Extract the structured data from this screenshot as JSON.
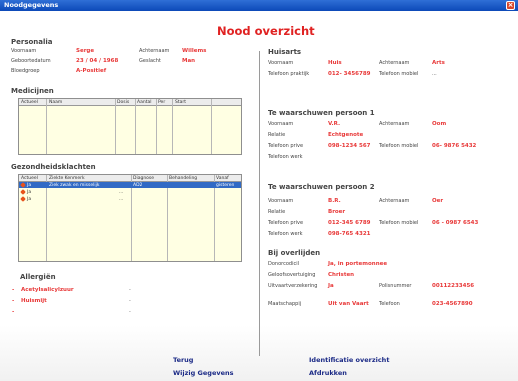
{
  "window": {
    "title": "Noodgegevens",
    "close_glyph": "×"
  },
  "heading": "Nood overzicht",
  "personalia": {
    "title": "Personalia",
    "voornaam_label": "Voornaam",
    "voornaam": "Serge",
    "achternaam_label": "Achternaam",
    "achternaam": "Willems",
    "geboortedatum_label": "Geboortedatum",
    "geboortedatum": "23 / 04 / 1968",
    "geslacht_label": "Geslacht",
    "geslacht": "Man",
    "bloedgroep_label": "Bloedgroep",
    "bloedgroep": "A-Positief"
  },
  "medicijnen": {
    "title": "Medicijnen",
    "columns": [
      "Actueel",
      "Naam",
      "Dosis",
      "Aantal",
      "Per",
      "Start"
    ]
  },
  "klachten": {
    "title": "Gezondheidsklachten",
    "columns": [
      "Actueel",
      "Ziekte Kenmerk",
      "Diagnose",
      "Behandeling",
      "Vanaf"
    ],
    "rows": [
      {
        "actueel": "Ja",
        "kenmerk": "Ziek zwak en misselijk",
        "diagnose": "AD2",
        "behandeling": "",
        "vanaf": "gisteren",
        "selected": true
      },
      {
        "actueel": "Ja",
        "kenmerk": "",
        "diagnose": "...",
        "behandeling": "",
        "vanaf": "",
        "selected": false
      },
      {
        "actueel": "Ja",
        "kenmerk": "",
        "diagnose": "...",
        "behandeling": "",
        "vanaf": "",
        "selected": false
      }
    ]
  },
  "allergien": {
    "title": "Allergiën",
    "items": [
      "Acetylsalicylzuur",
      "Huismijt",
      ""
    ]
  },
  "huisarts": {
    "title": "Huisarts",
    "voornaam_label": "Voornaam",
    "voornaam": "Huis",
    "achternaam_label": "Achternaam",
    "achternaam": "Arts",
    "telefoon_praktijk_label": "Telefoon praktijk",
    "telefoon_praktijk": "012- 3456789",
    "telefoon_mobiel_label": "Telefoon mobiel",
    "telefoon_mobiel": "..."
  },
  "persoon1": {
    "title": "Te waarschuwen persoon 1",
    "voornaam_label": "Voornaam",
    "voornaam": "V.R.",
    "achternaam_label": "Achternaam",
    "achternaam": "Oom",
    "relatie_label": "Relatie",
    "relatie": "Echtgenote",
    "telefoon_prive_label": "Telefoon prive",
    "telefoon_prive": "098-1234 567",
    "telefoon_mobiel_label": "Telefoon mobiel",
    "telefoon_mobiel": "06- 9876 5432",
    "telefoon_werk_label": "Telefoon werk",
    "telefoon_werk": ""
  },
  "persoon2": {
    "title": "Te waarschuwen persoon 2",
    "voornaam_label": "Voornaam",
    "voornaam": "B.R.",
    "achternaam_label": "Achternaam",
    "achternaam": "Oer",
    "relatie_label": "Relatie",
    "relatie": "Broer",
    "telefoon_prive_label": "Telefoon prive",
    "telefoon_prive": "012-345 6789",
    "telefoon_mobiel_label": "Telefoon mobiel",
    "telefoon_mobiel": "06 - 0987 6543",
    "telefoon_werk_label": "Telefoon werk",
    "telefoon_werk": "098-765 4321"
  },
  "overlijden": {
    "title": "Bij overlijden",
    "donorcodicil_label": "Donorcodicil",
    "donorcodicil": "Ja, in portemonnee",
    "geloof_label": "Geloofsovertuiging",
    "geloof": "Christen",
    "uitvaart_label": "Uitvaartverzekering",
    "uitvaart": "Ja",
    "polisnummer_label": "Polisnummer",
    "polisnummer": "00112233456",
    "maatschappij_label": "Maatschappij",
    "maatschappij": "Uit van Vaart",
    "telefoon_label": "Telefoon",
    "telefoon": "023-4567890"
  },
  "nav": {
    "terug": "Terug",
    "wijzig": "Wijzig Gegevens",
    "identificatie": "Identificatie overzicht",
    "afdrukken": "Afdrukken"
  },
  "colors": {
    "accent": "#e83838",
    "titlebar": "#1a5ccc",
    "nav": "#1b2a86",
    "selection": "#316ac5"
  }
}
